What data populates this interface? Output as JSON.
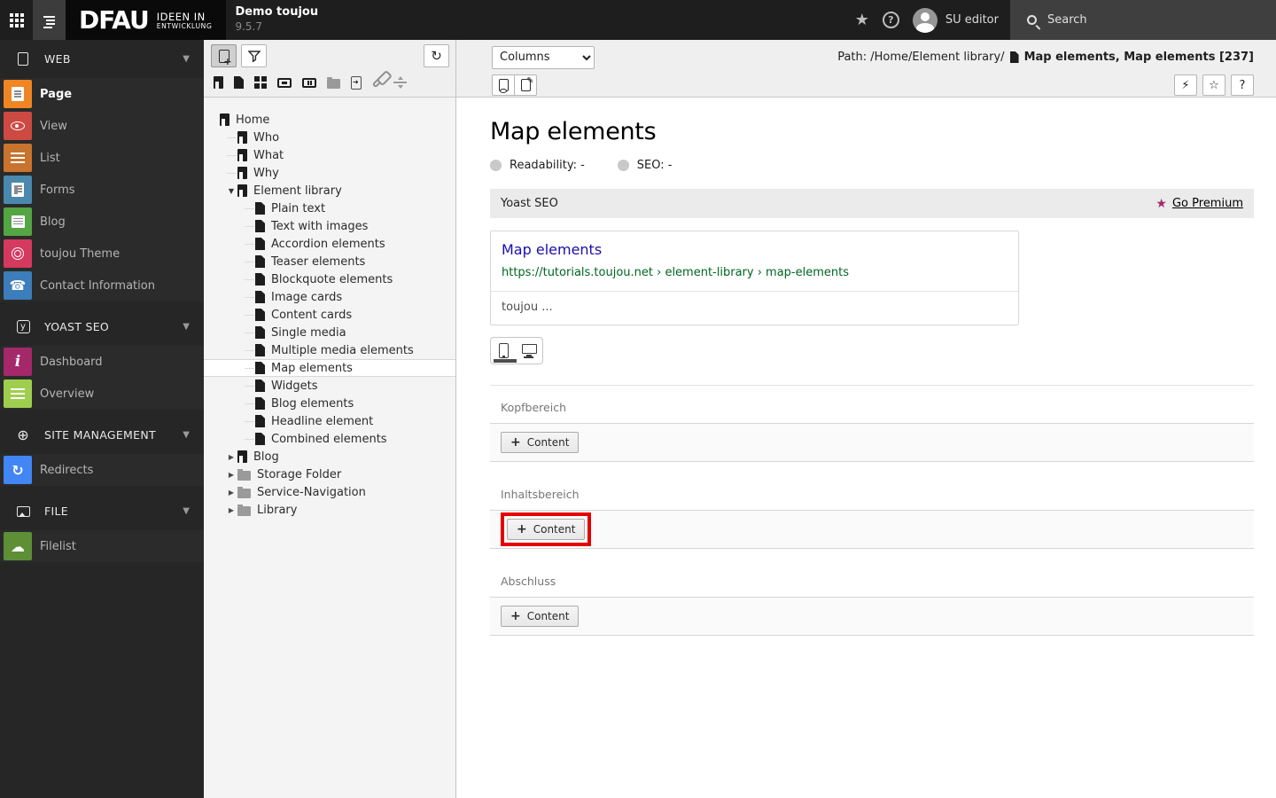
{
  "topbar": {
    "brand": {
      "logo": "DFAU",
      "tagline_line1": "IDEEN IN",
      "tagline_line2": "ENTWICKLUNG"
    },
    "site": {
      "name": "Demo toujou",
      "version": "9.5.7"
    },
    "help_label": "?",
    "user": {
      "label": "SU editor"
    },
    "search": {
      "label": "Search"
    },
    "icons": [
      "modules-grid-icon",
      "pagetree-toggle-icon",
      "bookmark-star-icon",
      "help-icon",
      "avatar",
      "search-icon"
    ]
  },
  "module_menu": {
    "sections": [
      {
        "label": "WEB",
        "icon": "document-outline-icon",
        "items": [
          {
            "label": "Page",
            "icon": "page-icon",
            "color": "#ef8523",
            "active": true
          },
          {
            "label": "View",
            "icon": "eye-icon",
            "color": "#cc4a42",
            "active": false
          },
          {
            "label": "List",
            "icon": "list-icon",
            "color": "#c8742e",
            "active": false
          },
          {
            "label": "Forms",
            "icon": "form-icon",
            "color": "#4a89ad",
            "active": false
          },
          {
            "label": "Blog",
            "icon": "news-icon",
            "color": "#54a543",
            "active": false
          },
          {
            "label": "toujou Theme",
            "icon": "fingerprint-icon",
            "color": "#d53a5e",
            "active": false
          },
          {
            "label": "Contact Information",
            "icon": "contact-icon",
            "color": "#3c7dbb",
            "active": false
          }
        ]
      },
      {
        "label": "YOAST SEO",
        "icon": "yoast-icon",
        "items": [
          {
            "label": "Dashboard",
            "icon": "info-icon",
            "color": "#a4286a",
            "active": false
          },
          {
            "label": "Overview",
            "icon": "bars-icon",
            "color": "#9fce4e",
            "active": false
          }
        ]
      },
      {
        "label": "SITE MANAGEMENT",
        "icon": "globe-icon",
        "items": [
          {
            "label": "Redirects",
            "icon": "redirect-icon",
            "color": "#4285f4",
            "active": false
          }
        ]
      },
      {
        "label": "FILE",
        "icon": "image-icon",
        "items": [
          {
            "label": "Filelist",
            "icon": "cloud-list-icon",
            "color": "#5d8f36",
            "active": false
          }
        ]
      }
    ]
  },
  "tree": {
    "toolbar_icons": [
      "new-page-icon",
      "filter-icon",
      "refresh-icon"
    ],
    "drag_page_type_icons": [
      "standard-page-icon",
      "plain-page-icon",
      "backend-section-icon",
      "mount-point-icon",
      "recycler-icon",
      "folder-icon",
      "paste-page-icon",
      "shortcut-link-icon",
      "divider-icon"
    ],
    "nodes": [
      {
        "label": "Home"
      },
      {
        "label": "Who"
      },
      {
        "label": "What"
      },
      {
        "label": "Why"
      },
      {
        "label": "Element library"
      },
      {
        "label": "Plain text"
      },
      {
        "label": "Text with images"
      },
      {
        "label": "Accordion elements"
      },
      {
        "label": "Teaser elements"
      },
      {
        "label": "Blockquote elements"
      },
      {
        "label": "Image cards"
      },
      {
        "label": "Content cards"
      },
      {
        "label": "Single media"
      },
      {
        "label": "Multiple media elements"
      },
      {
        "label": "Map elements",
        "selected": true
      },
      {
        "label": "Widgets"
      },
      {
        "label": "Blog elements"
      },
      {
        "label": "Headline element"
      },
      {
        "label": "Combined elements"
      },
      {
        "label": "Blog"
      },
      {
        "label": "Storage Folder"
      },
      {
        "label": "Service-Navigation"
      },
      {
        "label": "Library"
      }
    ]
  },
  "docheader": {
    "columns_label": "Columns",
    "path_prefix": "Path: /Home/Element library/",
    "page_reference": "Map elements, Map elements [237]",
    "help_label": "?",
    "action_icons": [
      "view-webpage-icon",
      "edit-page-icon",
      "clear-cache-icon",
      "bookmark-star-icon",
      "help-icon"
    ]
  },
  "content": {
    "title": "Map elements",
    "readability_label": "Readability: -",
    "seo_label": "SEO: -",
    "yoast": {
      "panel_title": "Yoast SEO",
      "premium_label": "Go Premium",
      "snippet_title": "Map elements",
      "snippet_url": "https://tutorials.toujou.net › element-library › map-elements",
      "snippet_description": "toujou ...",
      "device_icons": [
        "mobile-icon",
        "desktop-icon"
      ]
    },
    "sections": [
      {
        "label": "Kopfbereich",
        "button_label": "Content",
        "highlighted": false
      },
      {
        "label": "Inhaltsbereich",
        "button_label": "Content",
        "highlighted": true
      },
      {
        "label": "Abschluss",
        "button_label": "Content",
        "highlighted": false
      }
    ]
  },
  "colors": {
    "highlight_red": "#e60000",
    "yoast_magenta": "#a4286a",
    "snippet_title_blue": "#1a0dab",
    "snippet_url_green": "#006621",
    "topbar_bg": "#1e1e1e",
    "module_menu_bg": "#262626"
  }
}
